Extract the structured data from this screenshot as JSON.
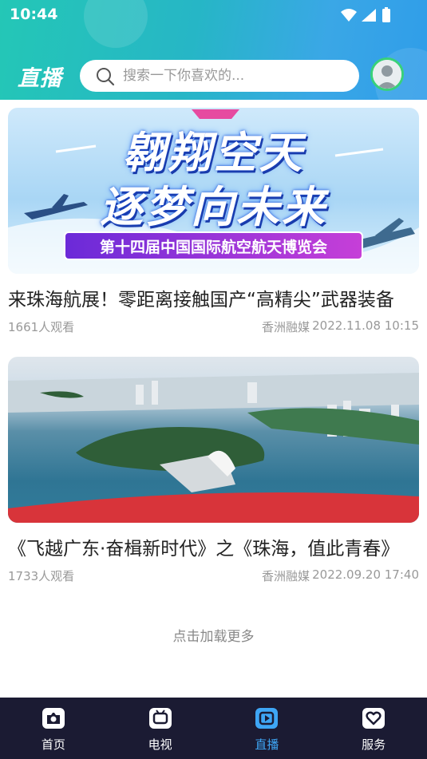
{
  "status_bar": {
    "time": "10:44"
  },
  "header": {
    "brand_title": "直播",
    "search": {
      "placeholder": "搜索一下你喜欢的..."
    }
  },
  "items": [
    {
      "thumbnail": {
        "headline_line1": "翱翔空天",
        "headline_line2": "逐梦向未来",
        "banner": "第十四届中国国际航空航天博览会"
      },
      "title": "来珠海航展！零距离接触国产“高精尖”武器装备",
      "views": "1661人观看",
      "source": "香洲融媒",
      "time": "2022.11.08 10:15"
    },
    {
      "thumbnail": {},
      "title": "《飞越广东·奋楫新时代》之《珠海，值此青春》",
      "views": "1733人观看",
      "source": "香洲融媒",
      "time": "2022.09.20 17:40"
    }
  ],
  "load_more": "点击加载更多",
  "tabbar": {
    "tabs": [
      {
        "label": "首页",
        "icon": "home-camera-icon",
        "active": false
      },
      {
        "label": "电视",
        "icon": "tv-icon",
        "active": false
      },
      {
        "label": "直播",
        "icon": "live-play-icon",
        "active": true
      },
      {
        "label": "服务",
        "icon": "heart-service-icon",
        "active": false
      }
    ]
  },
  "colors": {
    "header_gradient_start": "#24c7b6",
    "header_gradient_end": "#2f9de9",
    "tabbar_bg": "#1b1b33",
    "active_tab": "#3ea6f5"
  }
}
